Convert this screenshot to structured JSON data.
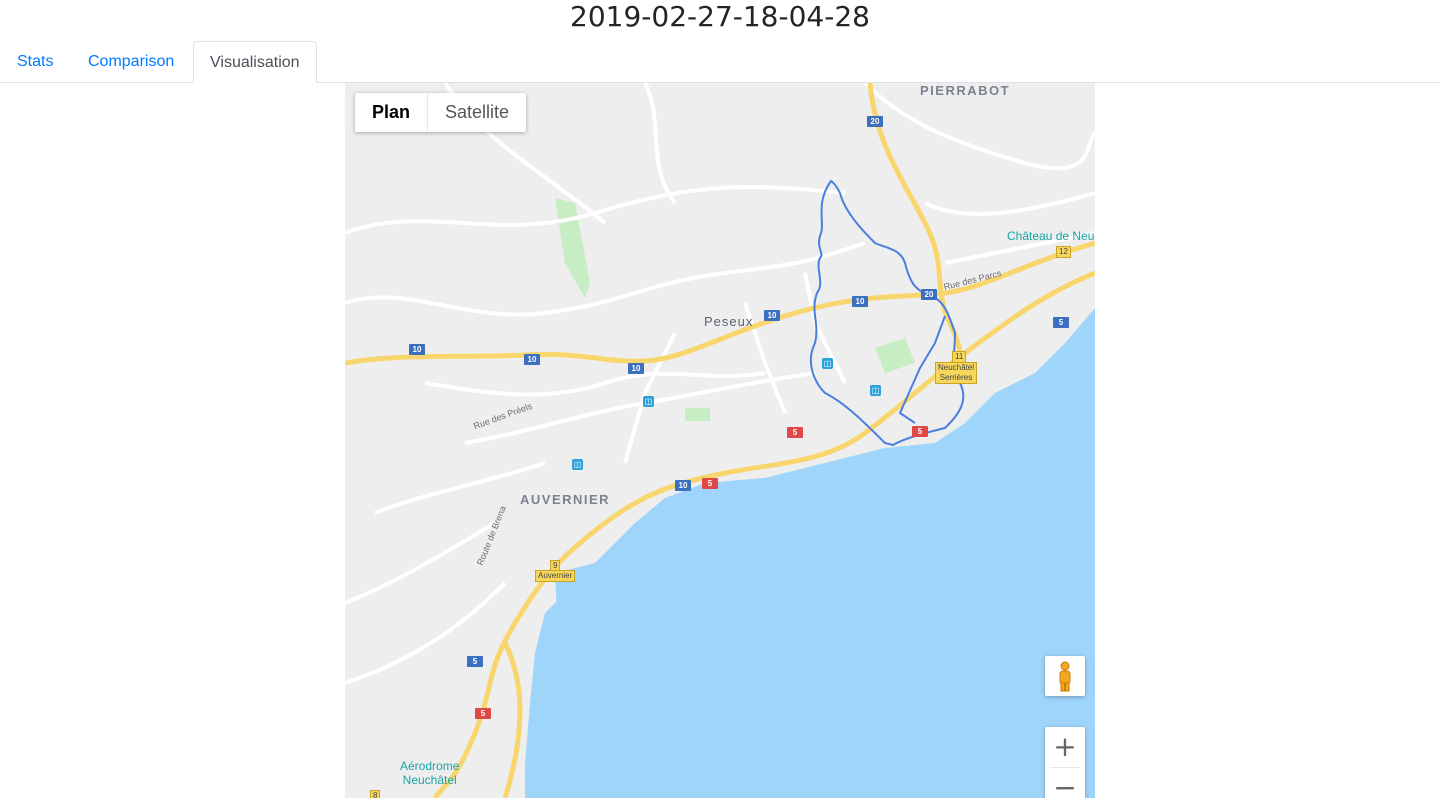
{
  "page": {
    "title": "2019-02-27-18-04-28"
  },
  "tabs": [
    {
      "label": "Stats",
      "active": false
    },
    {
      "label": "Comparison",
      "active": false
    },
    {
      "label": "Visualisation",
      "active": true
    }
  ],
  "map": {
    "type_control": {
      "plan_label": "Plan",
      "satellite_label": "Satellite",
      "selected": "Plan"
    },
    "zoom_in_label": "+",
    "zoom_out_label": "−",
    "place_labels": {
      "pierrabot": "PIERRABOT",
      "peseux": "Peseux",
      "auvernier": "AUVERNIER",
      "chateau": "Château de Neu",
      "aerodrome_line1": "Aérodrome",
      "aerodrome_line2": "Neuchâtel"
    },
    "road_labels": {
      "rue_des_parcs": "Rue des Parcs",
      "rue_des_preels": "Rue des Préels",
      "route_de_brena": "Route de Brena"
    },
    "exit_labels": {
      "neuchatel_serrieres_num": "11",
      "neuchatel_serrieres_line1": "Neuchâtel",
      "neuchatel_serrieres_line2": "Serrières",
      "auvernier_num": "9",
      "auvernier_name": "Auvernier",
      "exit_12": "12",
      "exit_8": "8"
    },
    "route_shields": {
      "s20": "20",
      "s10": "10",
      "s5": "5"
    },
    "colors": {
      "water": "#9fd5fb",
      "land": "#eeeeee",
      "highway": "#f8d66d",
      "park": "#c7edc4",
      "track": "#4a7fe0"
    }
  }
}
